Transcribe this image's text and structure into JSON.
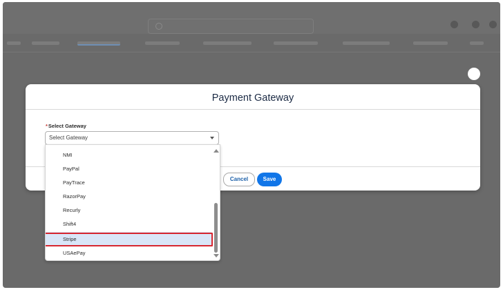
{
  "modal": {
    "title": "Payment Gateway",
    "field_label": "Select Gateway",
    "required_marker": "*",
    "select_value": "Select Gateway",
    "cancel_label": "Cancel",
    "save_label": "Save"
  },
  "dropdown": {
    "options": [
      "NMI",
      "PayPal",
      "PayTrace",
      "RazorPay",
      "Recurly",
      "Shift4",
      "Stripe",
      "USAePay"
    ],
    "selected": "Stripe"
  },
  "colors": {
    "primary": "#1176e8",
    "highlight": "#d7262f",
    "selected_bg": "#d9e6f8",
    "overlay": "#6a6a6a"
  },
  "icons": {
    "select_caret": "chevron-down-icon",
    "scroll_up": "triangle-up-icon",
    "scroll_down": "triangle-down-icon"
  }
}
